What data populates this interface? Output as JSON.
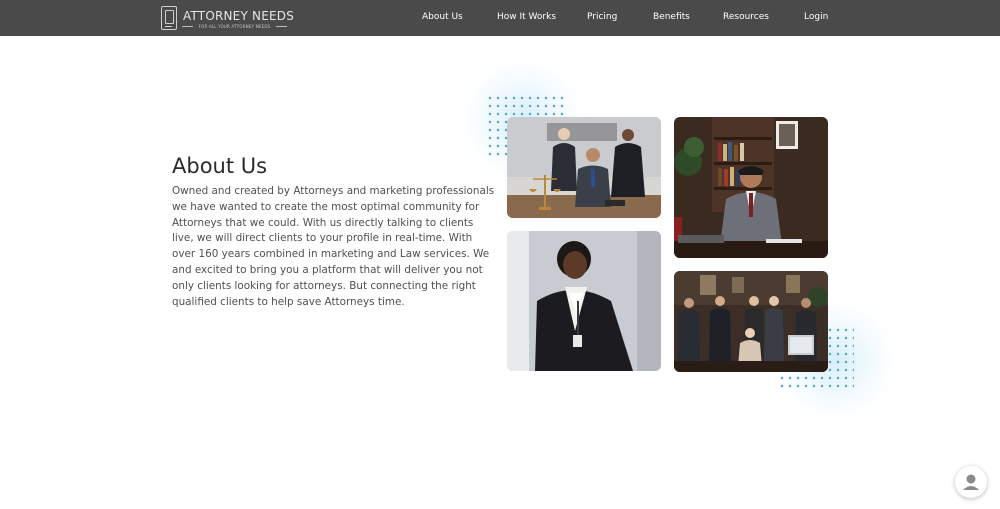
{
  "header": {
    "logo": {
      "title": "ATTORNEY NEEDS",
      "tagline": "FOR ALL YOUR ATTORNEY NEEDS"
    },
    "nav": [
      {
        "label": "About Us"
      },
      {
        "label": "How It Works"
      },
      {
        "label": "Pricing"
      },
      {
        "label": "Benefits"
      },
      {
        "label": "Resources"
      },
      {
        "label": "Login"
      }
    ]
  },
  "about": {
    "title": "About Us",
    "paragraph": "Owned and created by Attorneys and marketing professionals we have wanted to create the most optimal community for Attorneys that we could. With us directly talking to clients live, we will direct clients to your profile in real-time. With over 160 years combined in marketing and Law services. We and excited to bring you a platform that will deliver you not only clients looking for attorneys. But connecting the right qualified clients to help save Attorneys time."
  },
  "photos": [
    {
      "subject": "three attorneys seated at a conference table"
    },
    {
      "subject": "attorney in grey suit seated at desk in a library office"
    },
    {
      "subject": "attorney in black blazer standing in an office"
    },
    {
      "subject": "group of attorneys posing in a conference room"
    }
  ],
  "icons": {
    "logo": "attorney-needs-logo-icon",
    "chat": "user-avatar-icon"
  },
  "colors": {
    "header_bg": "#4a4a4a",
    "accent_dots": "#5ba3c9",
    "title": "#2b2b2b",
    "body_text": "#505050"
  }
}
